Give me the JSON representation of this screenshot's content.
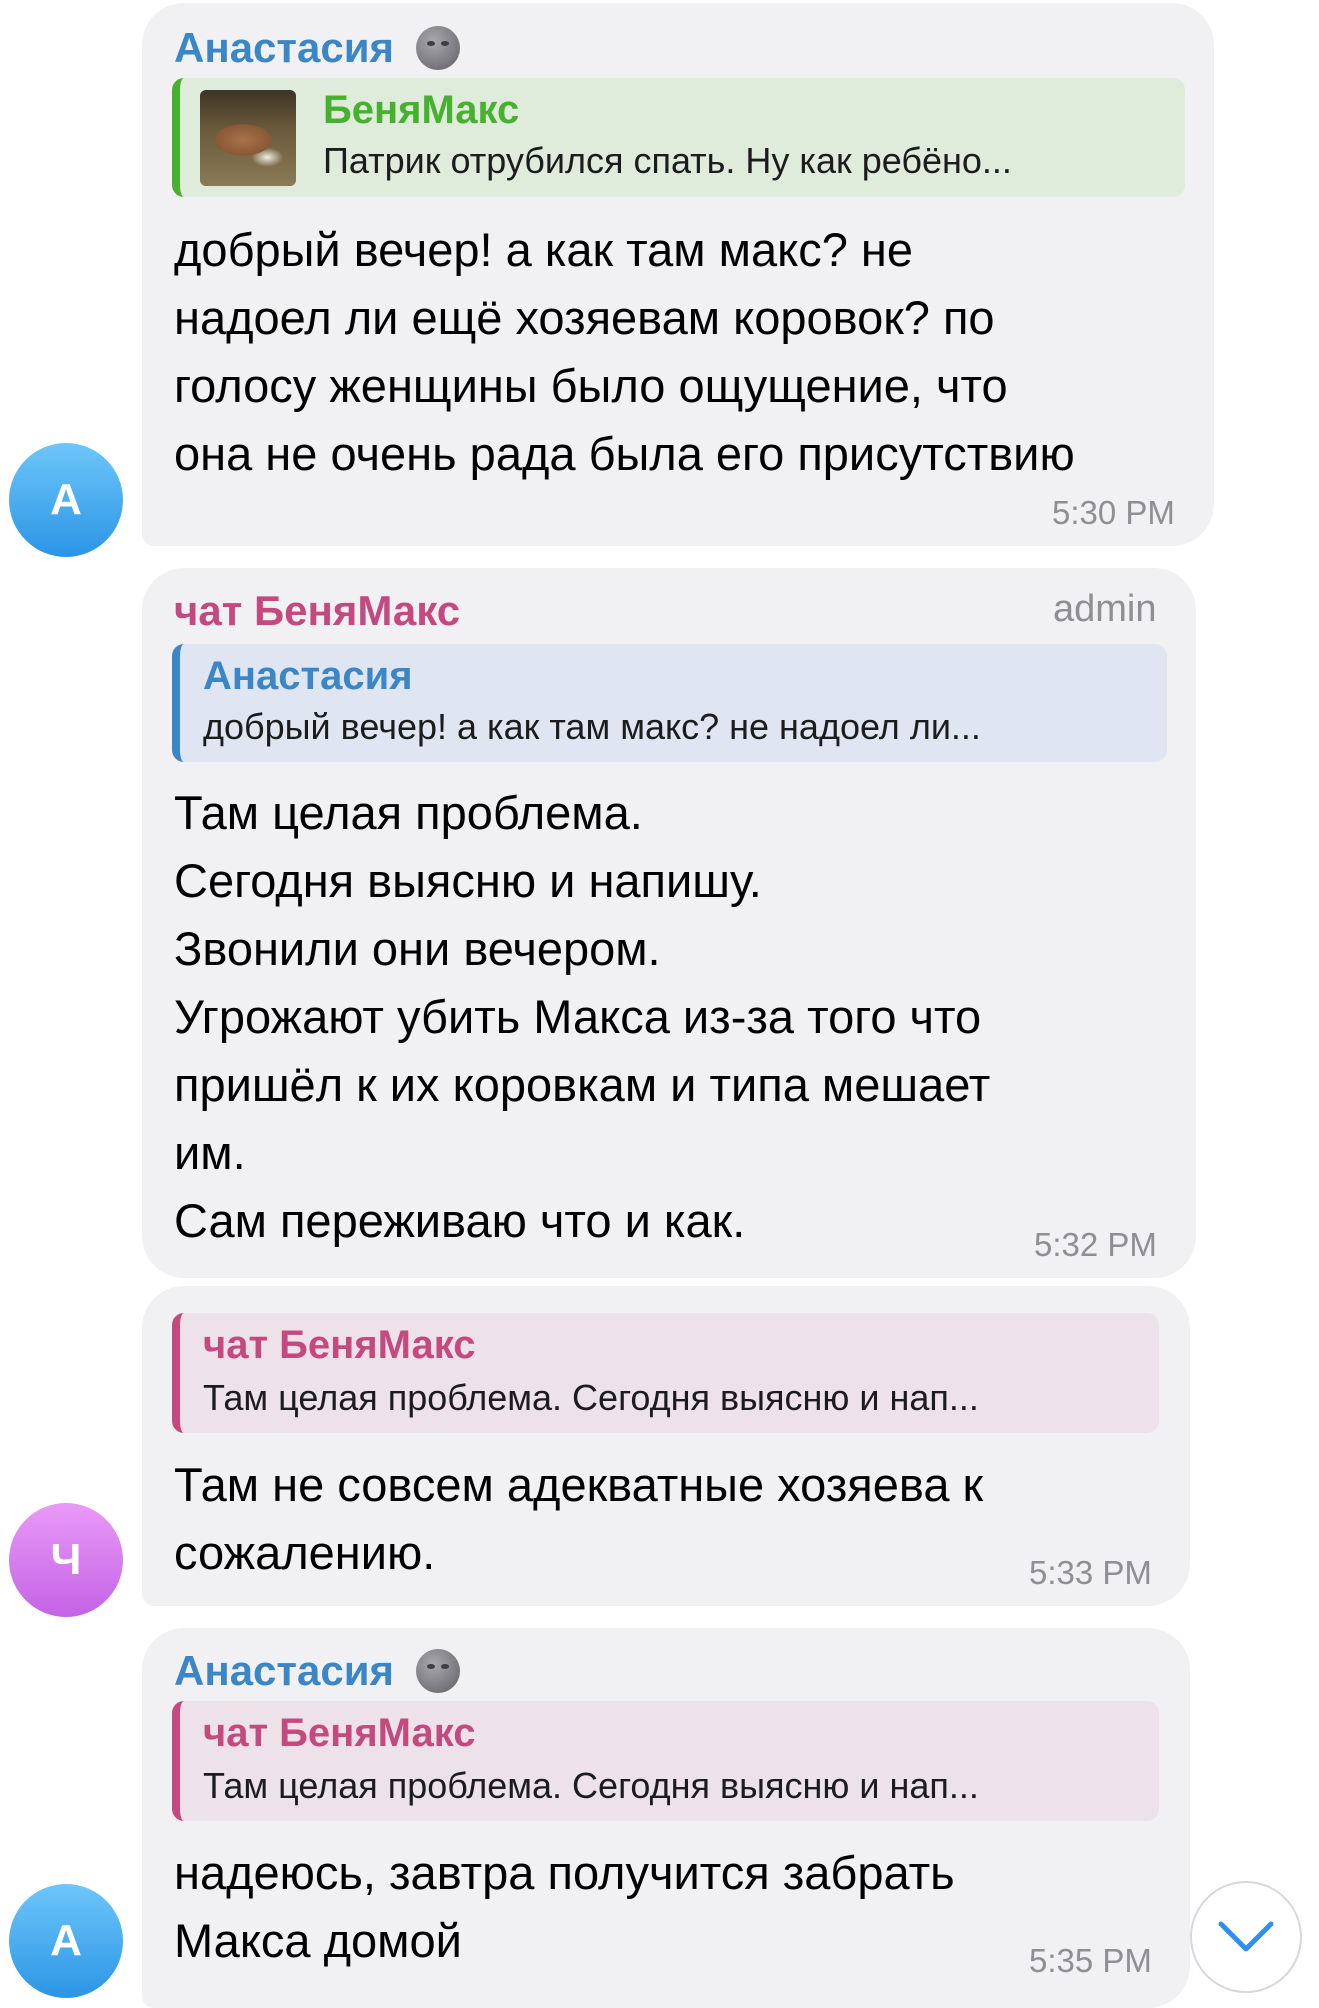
{
  "messages": [
    {
      "avatar_letter": "А",
      "sender": "Анастасия",
      "reply": {
        "title": "БеняМакс",
        "text": "Патрик отрубился спать. Ну как ребёно..."
      },
      "text": "добрый вечер! а как там макс? не\nнадоел ли ещё хозяевам коровок? по\nголосу женщины было ощущение, что\nона не очень рада была его присутствию",
      "time": "5:30 PM"
    },
    {
      "sender": "чат БеняМакс",
      "badge": "admin",
      "reply": {
        "title": "Анастасия",
        "text": "добрый вечер! а как там макс? не надоел ли..."
      },
      "text": "Там целая проблема.\nСегодня выясню и напишу.\nЗвонили они вечером.\nУгрожают убить Макса из-за того что\nпришёл к их коровкам и типа мешает\nим.\nСам переживаю что и как.",
      "time": "5:32 PM"
    },
    {
      "avatar_letter": "Ч",
      "reply": {
        "title": "чат БеняМакс",
        "text": "Там целая проблема. Сегодня выясню и нап..."
      },
      "text": "Там не совсем адекватные хозяева к\nсожалению.",
      "time": "5:33 PM"
    },
    {
      "avatar_letter": "А",
      "sender": "Анастасия",
      "reply": {
        "title": "чат БеняМакс",
        "text": "Там целая проблема. Сегодня выясню и нап..."
      },
      "text": "надеюсь, завтра получится забрать\nМакса домой",
      "time": "5:35 PM"
    }
  ],
  "icons": {
    "sender_emoji": "new-moon-face-icon",
    "scroll_button": "chevron-down-icon",
    "reply_thumbnail": "sleeping-calf-photo"
  },
  "colors": {
    "bubble_bg": "#f1f1f4",
    "sender_blue": "#3a86c6",
    "sender_pink": "#c4497f",
    "reply_green": "#46b12d",
    "time_gray": "#8e8e93",
    "avatar_blue": "#2b95e6",
    "avatar_purple": "#c463e6",
    "scroll_arrow": "#2f8ff0"
  }
}
